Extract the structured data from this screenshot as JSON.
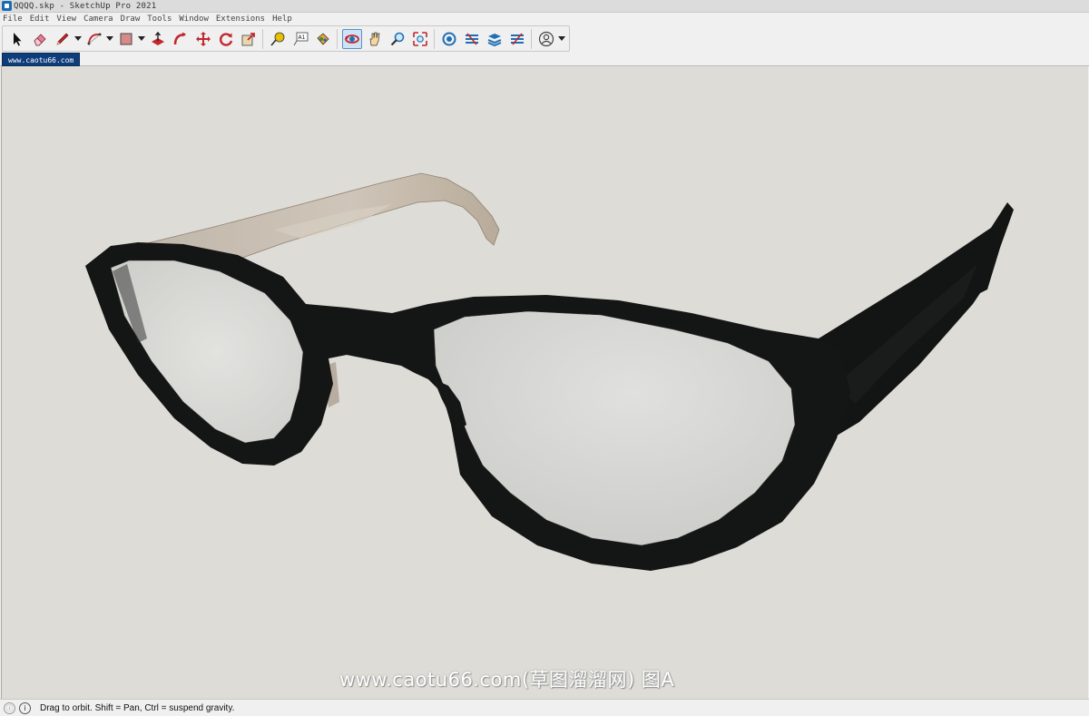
{
  "window": {
    "title": "QQQQ.skp - SketchUp Pro 2021"
  },
  "menu": [
    "File",
    "Edit",
    "View",
    "Camera",
    "Draw",
    "Tools",
    "Window",
    "Extensions",
    "Help"
  ],
  "scene_tab": "www.caotu66.com",
  "toolbar": {
    "active_tool": "orbit",
    "text_tool_label": "A1",
    "tools": [
      "select",
      "eraser",
      "line",
      "arc",
      "shape",
      "push-pull",
      "follow-me",
      "move",
      "rotate",
      "scale",
      "tape-measure",
      "text",
      "paint-bucket",
      "orbit",
      "pan",
      "zoom",
      "zoom-extents",
      "3d-warehouse",
      "extension-warehouse",
      "layout",
      "extension-manager",
      "account"
    ]
  },
  "watermark": "www.caotu66.com(草图溜溜网) 图A",
  "status": {
    "geo_icon": "ⓘ",
    "info_icon": "i",
    "text": "Drag to orbit. Shift = Pan, Ctrl = suspend gravity."
  },
  "colors": {
    "viewport_bg": "#dddcd6",
    "frame": "#141515",
    "temple": "#c9bfb3",
    "lens": "#d6d6d3",
    "scene_tab_bg": "#0f3d7a",
    "active_tool": "#cfe3f7"
  }
}
